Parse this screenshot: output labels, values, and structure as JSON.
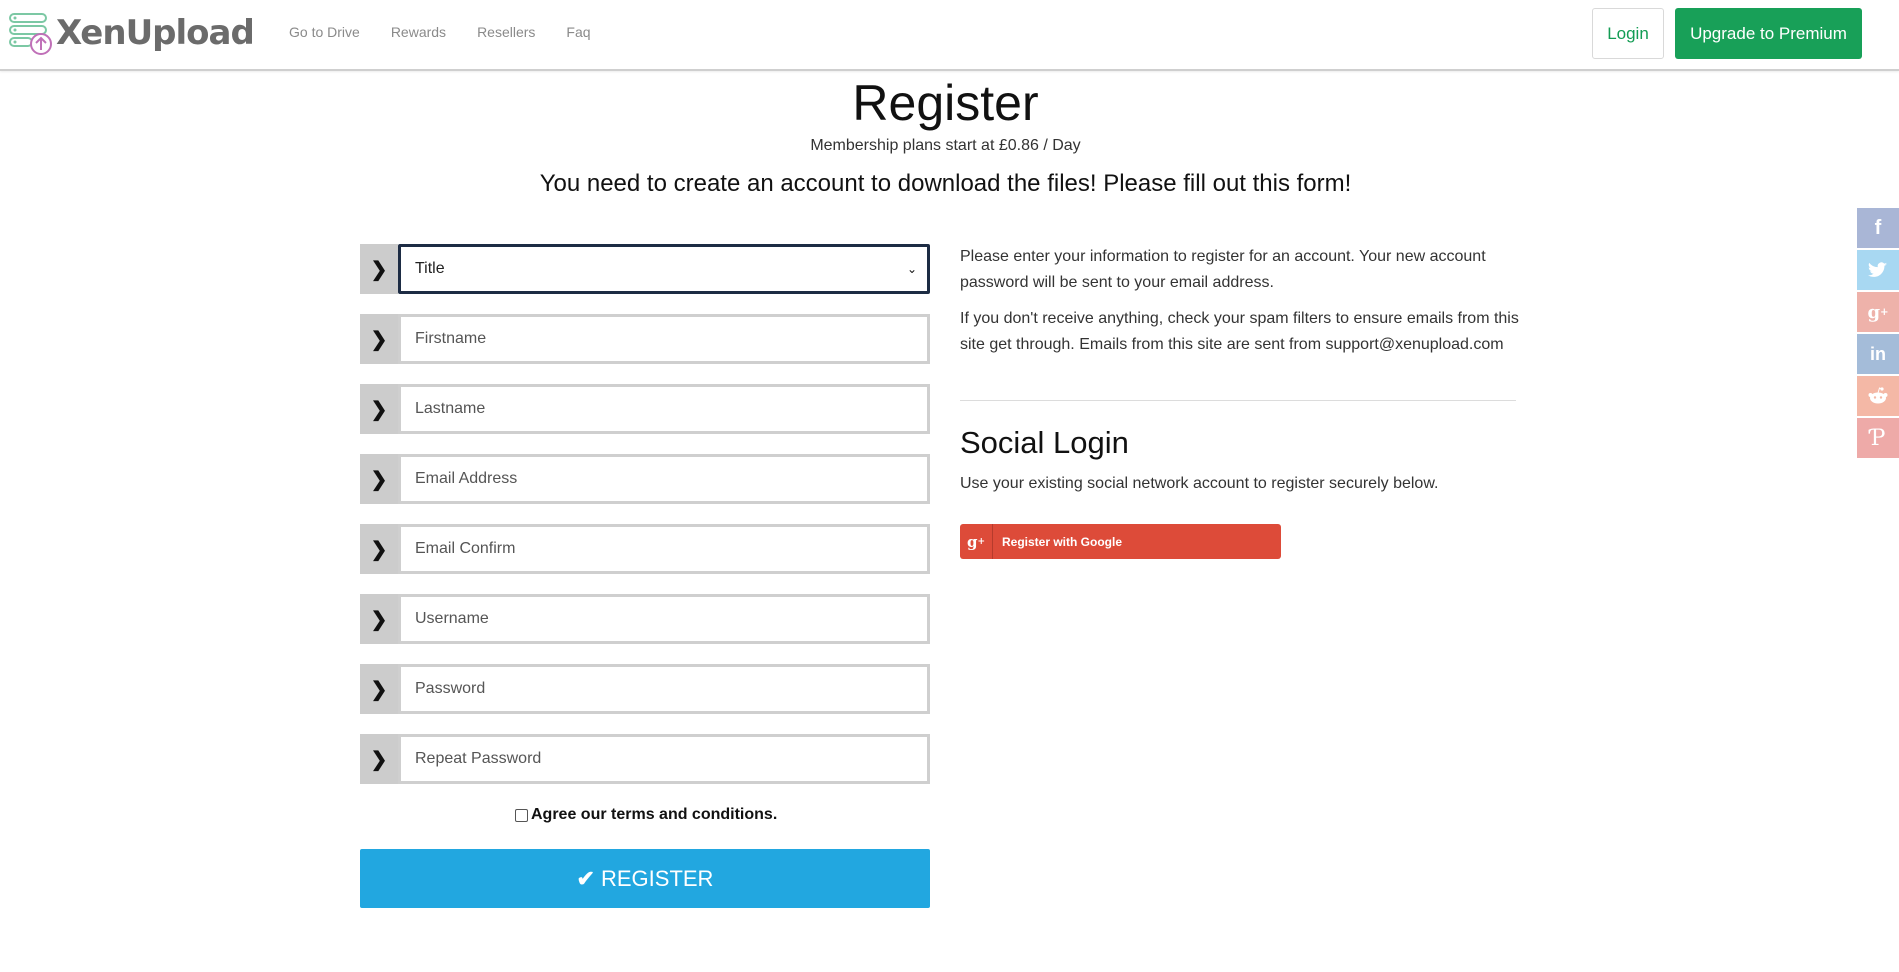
{
  "header": {
    "logo_text": "XenUpload",
    "nav": [
      "Go to Drive",
      "Rewards",
      "Resellers",
      "Faq"
    ],
    "login_label": "Login",
    "premium_label": "Upgrade to Premium"
  },
  "main": {
    "title": "Register",
    "subtitle": "Membership plans start at £0.86 / Day",
    "notice": "You need to create an account to download the files! Please fill out this form!"
  },
  "form": {
    "title_select": "Title",
    "firstname_placeholder": "Firstname",
    "lastname_placeholder": "Lastname",
    "email_placeholder": "Email Address",
    "email_confirm_placeholder": "Email Confirm",
    "username_placeholder": "Username",
    "password_placeholder": "Password",
    "repeat_password_placeholder": "Repeat Password",
    "agree_label": "Agree our terms and conditions.",
    "register_label": "REGISTER"
  },
  "info": {
    "paragraph1": "Please enter your information to register for an account. Your new account password will be sent to your email address.",
    "paragraph2": "If you don't receive anything, check your spam filters to ensure emails from this site get through. Emails from this site are sent from support@xenupload.com",
    "social_title": "Social Login",
    "social_desc": "Use your existing social network account to register securely below.",
    "google_label": "Register with Google"
  },
  "share": {
    "icons": [
      "facebook-icon",
      "twitter-icon",
      "google-plus-icon",
      "linkedin-icon",
      "reddit-icon",
      "pinterest-icon"
    ],
    "colors": [
      "#a9b6d6",
      "#a8d8f2",
      "#eeb2aa",
      "#a4bcd9",
      "#f4b8a6",
      "#eeaaa8"
    ]
  },
  "colors": {
    "accent_green": "#18a058",
    "register_blue": "#22a7e0",
    "google_red": "#dd4b39"
  }
}
